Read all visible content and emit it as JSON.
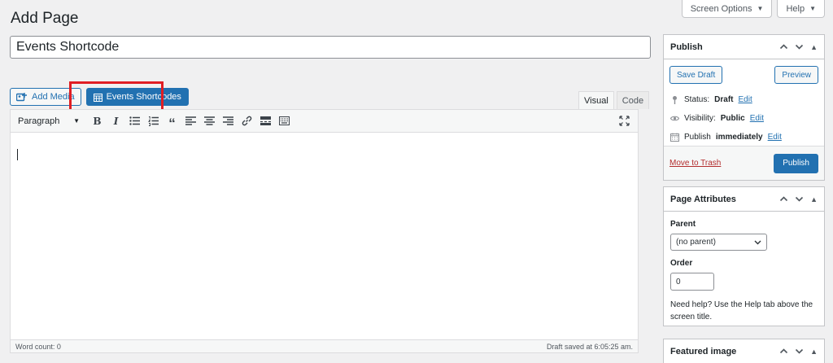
{
  "header": {
    "page_title": "Add Page",
    "screen_options_label": "Screen Options",
    "help_label": "Help"
  },
  "post": {
    "title_value": "Events Shortcode"
  },
  "media_buttons": {
    "add_media_label": "Add Media",
    "events_shortcodes_label": "Events Shortcodes"
  },
  "editor": {
    "tabs": [
      "Visual",
      "Code"
    ],
    "active_tab": "Visual",
    "format_select_value": "Paragraph",
    "word_count": "Word count: 0",
    "draft_saved": "Draft saved at 6:05:25 am."
  },
  "publish_box": {
    "title": "Publish",
    "save_draft_label": "Save Draft",
    "preview_label": "Preview",
    "status_label": "Status:",
    "status_value": "Draft",
    "visibility_label": "Visibility:",
    "visibility_value": "Public",
    "publish_label": "Publish",
    "publish_value": "immediately",
    "edit_label": "Edit",
    "trash_label": "Move to Trash",
    "publish_button_label": "Publish"
  },
  "attributes_box": {
    "title": "Page Attributes",
    "parent_label": "Parent",
    "parent_value": "(no parent)",
    "order_label": "Order",
    "order_value": "0",
    "help_text": "Need help? Use the Help tab above the screen title."
  },
  "featured_box": {
    "title": "Featured image"
  },
  "colors": {
    "accent": "#2271b1",
    "highlight": "#e01e24",
    "trash": "#b32d2e"
  }
}
